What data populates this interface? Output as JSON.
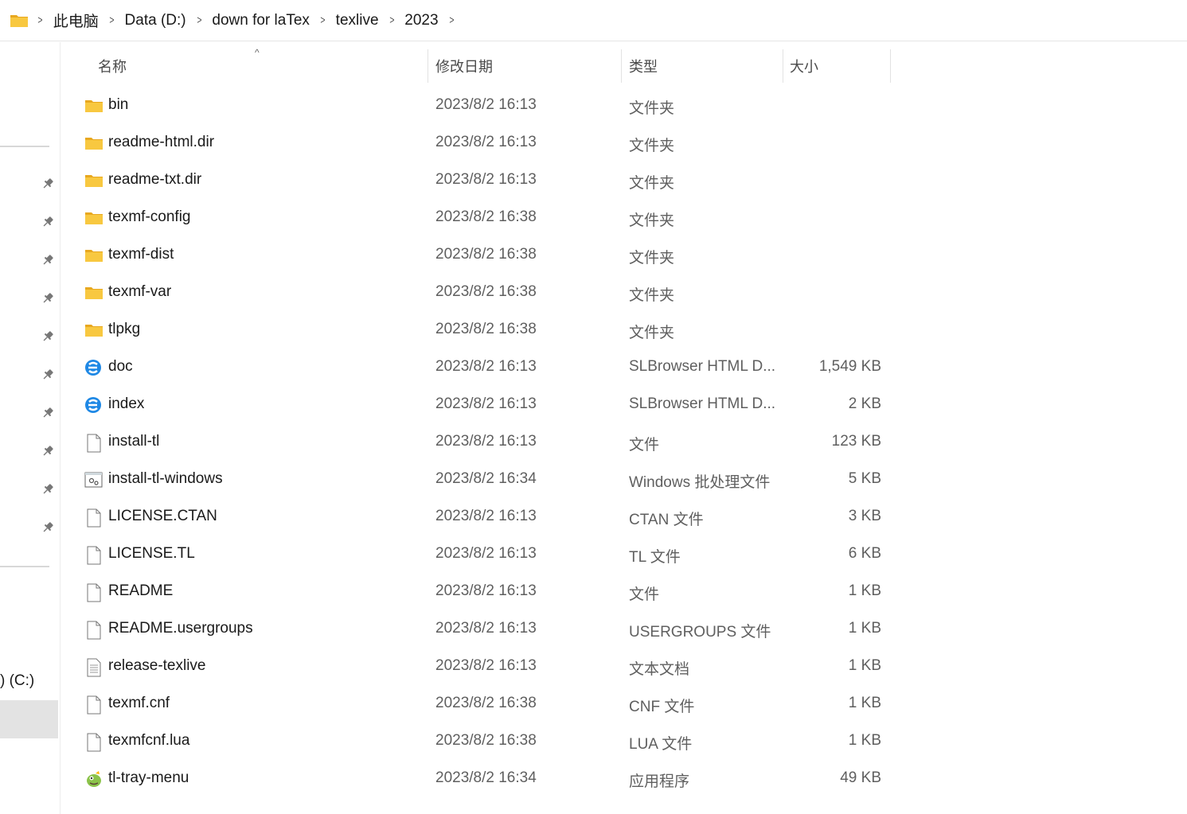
{
  "breadcrumb": [
    "此电脑",
    "Data (D:)",
    "down for laTex",
    "texlive",
    "2023"
  ],
  "nav": {
    "drive_label": ") (C:)"
  },
  "columns": {
    "name": "名称",
    "date": "修改日期",
    "type": "类型",
    "size": "大小"
  },
  "files": [
    {
      "name": "bin",
      "date": "2023/8/2 16:13",
      "type": "文件夹",
      "size": "",
      "icon": "folder-icon"
    },
    {
      "name": "readme-html.dir",
      "date": "2023/8/2 16:13",
      "type": "文件夹",
      "size": "",
      "icon": "folder-icon"
    },
    {
      "name": "readme-txt.dir",
      "date": "2023/8/2 16:13",
      "type": "文件夹",
      "size": "",
      "icon": "folder-icon"
    },
    {
      "name": "texmf-config",
      "date": "2023/8/2 16:38",
      "type": "文件夹",
      "size": "",
      "icon": "folder-icon"
    },
    {
      "name": "texmf-dist",
      "date": "2023/8/2 16:38",
      "type": "文件夹",
      "size": "",
      "icon": "folder-icon"
    },
    {
      "name": "texmf-var",
      "date": "2023/8/2 16:38",
      "type": "文件夹",
      "size": "",
      "icon": "folder-icon"
    },
    {
      "name": "tlpkg",
      "date": "2023/8/2 16:38",
      "type": "文件夹",
      "size": "",
      "icon": "folder-icon"
    },
    {
      "name": "doc",
      "date": "2023/8/2 16:13",
      "type": "SLBrowser HTML D...",
      "size": "1,549 KB",
      "icon": "browser-icon"
    },
    {
      "name": "index",
      "date": "2023/8/2 16:13",
      "type": "SLBrowser HTML D...",
      "size": "2 KB",
      "icon": "browser-icon"
    },
    {
      "name": "install-tl",
      "date": "2023/8/2 16:13",
      "type": "文件",
      "size": "123 KB",
      "icon": "file-icon"
    },
    {
      "name": "install-tl-windows",
      "date": "2023/8/2 16:34",
      "type": "Windows 批处理文件",
      "size": "5 KB",
      "icon": "batch-file-icon"
    },
    {
      "name": "LICENSE.CTAN",
      "date": "2023/8/2 16:13",
      "type": "CTAN 文件",
      "size": "3 KB",
      "icon": "file-icon"
    },
    {
      "name": "LICENSE.TL",
      "date": "2023/8/2 16:13",
      "type": "TL 文件",
      "size": "6 KB",
      "icon": "file-icon"
    },
    {
      "name": "README",
      "date": "2023/8/2 16:13",
      "type": "文件",
      "size": "1 KB",
      "icon": "file-icon"
    },
    {
      "name": "README.usergroups",
      "date": "2023/8/2 16:13",
      "type": "USERGROUPS 文件",
      "size": "1 KB",
      "icon": "file-icon"
    },
    {
      "name": "release-texlive",
      "date": "2023/8/2 16:13",
      "type": "文本文档",
      "size": "1 KB",
      "icon": "text-document-icon"
    },
    {
      "name": "texmf.cnf",
      "date": "2023/8/2 16:38",
      "type": "CNF 文件",
      "size": "1 KB",
      "icon": "file-icon"
    },
    {
      "name": "texmfcnf.lua",
      "date": "2023/8/2 16:38",
      "type": "LUA 文件",
      "size": "1 KB",
      "icon": "file-icon"
    },
    {
      "name": "tl-tray-menu",
      "date": "2023/8/2 16:34",
      "type": "应用程序",
      "size": "49 KB",
      "icon": "application-icon"
    }
  ],
  "colors": {
    "folder": "#F8C840",
    "folder_dark": "#E8A820",
    "browser": "#1E88E5",
    "selection": "#E3E3E3"
  }
}
